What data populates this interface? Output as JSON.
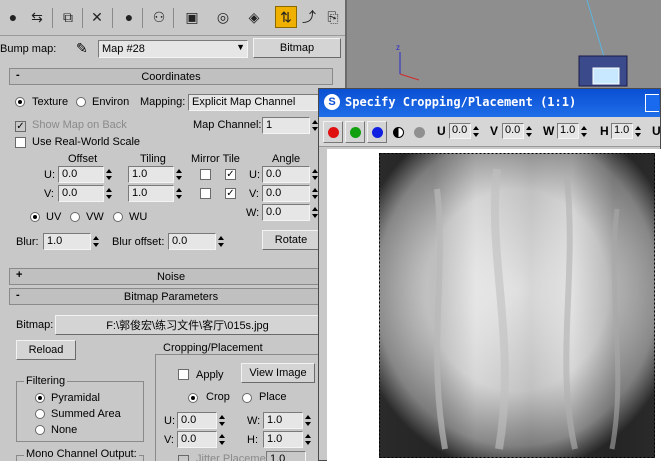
{
  "toolbar": {
    "buttons": [
      "get-material-icon",
      "put-material-icon",
      "assign-material-icon",
      "delete-icon",
      "make-unique-icon",
      "material-id-icon",
      "show-map-icon",
      "show-end-result-icon",
      "background-icon",
      "go-to-parent-icon",
      "go-forward-icon",
      "pick-from-object-icon"
    ]
  },
  "bump_map": {
    "label": "Bump map:",
    "map_name": "Map #28",
    "type_button": "Bitmap"
  },
  "coordinates": {
    "title": "Coordinates",
    "collapse_sign": "-",
    "texture_label": "Texture",
    "environ_label": "Environ",
    "mapping_label": "Mapping:",
    "mapping_value": "Explicit Map Channel",
    "show_map_on_back": "Show Map on Back",
    "map_channel_label": "Map Channel:",
    "map_channel_value": "1",
    "real_world_scale": "Use Real-World Scale",
    "offset_header": "Offset",
    "tiling_header": "Tiling",
    "mirror_tile_header": "Mirror Tile",
    "angle_header": "Angle",
    "u_label": "U:",
    "v_label": "V:",
    "w_label": "W:",
    "offset_u": "0.0",
    "offset_v": "0.0",
    "tiling_u": "1.0",
    "tiling_v": "1.0",
    "tile_mark": "✓",
    "angle_u": "0.0",
    "angle_v": "0.0",
    "angle_w": "0.0",
    "uv_label": "UV",
    "vw_label": "VW",
    "wu_label": "WU",
    "blur_label": "Blur:",
    "blur_value": "1.0",
    "blur_offset_label": "Blur offset:",
    "blur_offset_value": "0.0",
    "rotate_button": "Rotate"
  },
  "noise": {
    "title": "Noise",
    "collapse_sign": "+"
  },
  "bitmap_params": {
    "title": "Bitmap Parameters",
    "collapse_sign": "-",
    "bitmap_label": "Bitmap:",
    "bitmap_path": "F:\\郭俊宏\\练习文件\\客厅\\015s.jpg",
    "reload_button": "Reload",
    "filtering_title": "Filtering",
    "filter_options": [
      "Pyramidal",
      "Summed Area",
      "None"
    ],
    "mono_channel_title": "Mono Channel Output:",
    "cropping_title": "Cropping/Placement",
    "apply_label": "Apply",
    "view_image_button": "View Image",
    "crop_label": "Crop",
    "place_label": "Place",
    "crop_u": "0.0",
    "crop_v": "0.0",
    "crop_w": "1.0",
    "crop_h": "1.0",
    "h_label": "H:",
    "jitter_label": "Jitter Placement:",
    "jitter_value": "1.0"
  },
  "dialog": {
    "title": "Specify Cropping/Placement (1:1)",
    "u_label": "U",
    "u_value": "0.0",
    "v_label": "V",
    "v_value": "0.0",
    "w_label": "W",
    "w_value": "1.0",
    "h_label": "H",
    "h_value": "1.0",
    "trailing_label": "U"
  },
  "colors": {
    "panel_bg": "#c8c8c8",
    "title_bar": "#0a4fd4",
    "active_tool": "#f0b000",
    "viewport_bg": "#8e8e8e",
    "red_channel": "#e01010",
    "green_channel": "#10a010",
    "blue_channel": "#1020e0"
  }
}
